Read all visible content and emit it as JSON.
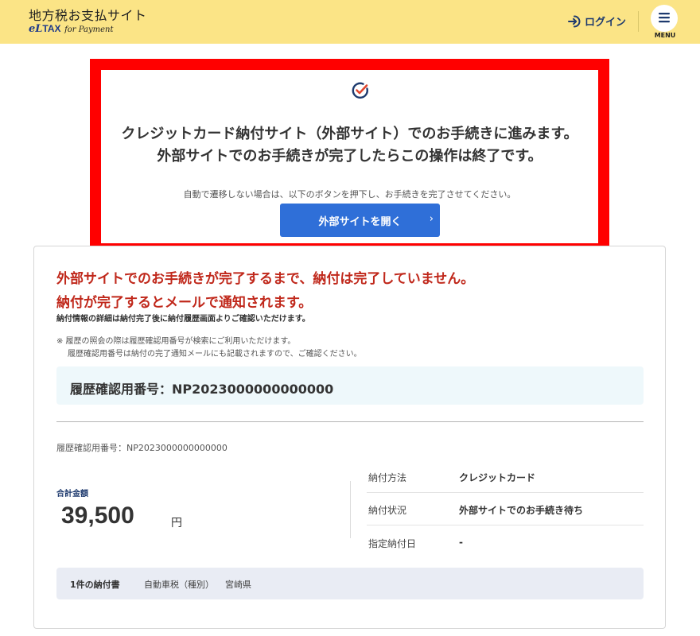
{
  "header": {
    "site_title": "地方税お支払サイト",
    "brand_el": "eL",
    "brand_tax": "TAX",
    "brand_payment": "for Payment",
    "login_label": "ログイン",
    "menu_label": "MENU"
  },
  "redirect": {
    "title_line1": "クレジットカード納付サイト（外部サイト）でのお手続きに進みます。",
    "title_line2": "外部サイトでのお手続きが完了したらこの操作は終了です。",
    "note": "自動で遷移しない場合は、以下のボタンを押下し、お手続きを完了させてください。",
    "button_label": "外部サイトを開く"
  },
  "status": {
    "warning_line1": "外部サイトでのお手続きが完了するまで、納付は完了していません。",
    "warning_line2": "納付が完了するとメールで通知されます。",
    "sub_note": "納付情報の詳細は納付完了後に納付履歴画面よりご確認いただけます。",
    "note_line1": "※ 履歴の照会の際は履歴確認用番号が検索にご利用いただけます。",
    "note_line2": "履歴確認用番号は納付の完了通知メールにも記載されますので、ご確認ください。"
  },
  "reference": {
    "box_text": "履歴確認用番号：NP2023000000000000",
    "small_text": "履歴確認用番号：NP2023000000000000"
  },
  "summary": {
    "total_label": "合計金額",
    "total_amount": "39,500",
    "total_unit": "円",
    "rows": [
      {
        "key": "納付方法",
        "value": "クレジットカード"
      },
      {
        "key": "納付状況",
        "value": "外部サイトでのお手続き待ち"
      },
      {
        "key": "指定納付日",
        "value": "-"
      }
    ]
  },
  "documents": {
    "count": "1件の納付書",
    "tax_type": "自動車税（種別）",
    "prefecture": "宮崎県"
  },
  "colors": {
    "header_bg": "#fbe486",
    "highlight_border": "#ff0000",
    "primary_button": "#2f6fd8",
    "warning_text": "#c0281b",
    "navy": "#1e3a6e"
  },
  "icons": {
    "login": "login-arrow-icon",
    "menu": "hamburger-icon",
    "check": "check-circle-icon",
    "chevron": "chevron-right-icon"
  }
}
